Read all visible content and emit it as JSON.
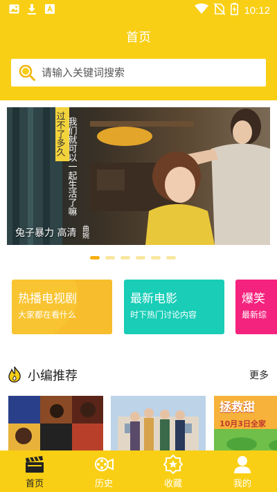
{
  "status_bar": {
    "time": "10:12",
    "left_icons": [
      "image-icon",
      "download-icon",
      "text-a-icon"
    ],
    "right_icons": [
      "wifi-icon",
      "no-sim-icon",
      "battery-charging-icon"
    ]
  },
  "header": {
    "title": "首页",
    "background": "#F9CF15"
  },
  "search": {
    "placeholder": "请输入关键词搜索",
    "icon": "search-icon"
  },
  "banner": {
    "caption": "兔子暴力 高清",
    "poster_text": "我们就可以一起生活了嘛",
    "poster_text_side": "过不了多久，",
    "poster_text_corner": "曲婉",
    "dots_count": 6,
    "active_dot": 0
  },
  "categories": [
    {
      "title": "热播电视剧",
      "subtitle": "大家都在看什么",
      "color": "#F9C431"
    },
    {
      "title": "最新电影",
      "subtitle": "时下热门讨论内容",
      "color": "#19CDB7"
    },
    {
      "title": "爆笑",
      "subtitle": "最新综",
      "color": "#F4237E"
    }
  ],
  "recommend": {
    "title": "小编推荐",
    "more": "更多",
    "posters": [
      {
        "name": "poster-1",
        "text": ""
      },
      {
        "name": "poster-2",
        "text": ""
      },
      {
        "name": "poster-3",
        "text": "拯救甜",
        "sub": "10月3日全家"
      }
    ]
  },
  "bottom_nav": {
    "items": [
      {
        "label": "首页",
        "icon": "clapperboard-icon",
        "active": true
      },
      {
        "label": "历史",
        "icon": "film-reel-icon",
        "active": false
      },
      {
        "label": "收藏",
        "icon": "star-badge-icon",
        "active": false
      },
      {
        "label": "我的",
        "icon": "user-icon",
        "active": false
      }
    ]
  }
}
